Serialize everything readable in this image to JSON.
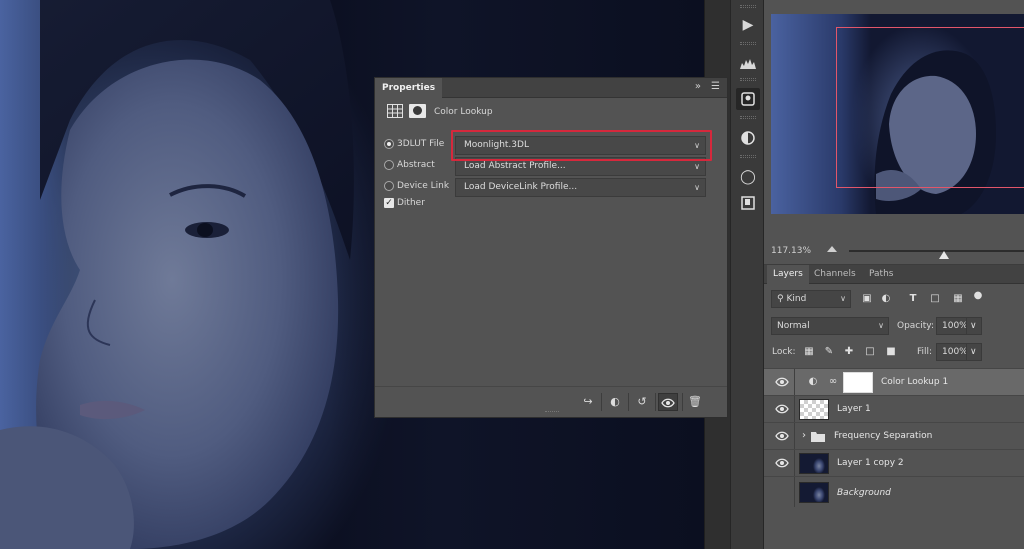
{
  "properties": {
    "title": "Properties",
    "adjustment_type": "Color Lookup",
    "options": [
      {
        "label": "3DLUT File",
        "selected": true,
        "dropdown": "Moonlight.3DL"
      },
      {
        "label": "Abstract",
        "selected": false,
        "dropdown": "Load Abstract Profile..."
      },
      {
        "label": "Device Link",
        "selected": false,
        "dropdown": "Load DeviceLink Profile..."
      }
    ],
    "dither": {
      "label": "Dither",
      "checked": true
    },
    "highlight_color": "#d6283c"
  },
  "navigator": {
    "zoom": "117.13%",
    "view_box_color": "#e2566a"
  },
  "layers_panel": {
    "tabs": [
      "Layers",
      "Channels",
      "Paths"
    ],
    "active_tab": "Layers",
    "filter_kind": "Kind",
    "blend_mode": "Normal",
    "opacity_label": "Opacity:",
    "opacity_value": "100%",
    "lock_label": "Lock:",
    "fill_label": "Fill:",
    "fill_value": "100%",
    "layers": [
      {
        "name": "Color Lookup 1",
        "visible": true,
        "selected": true
      },
      {
        "name": "Layer 1",
        "visible": true,
        "selected": false
      },
      {
        "name": "Frequency Separation",
        "visible": true,
        "selected": false,
        "group": true
      },
      {
        "name": "Layer 1 copy 2",
        "visible": true,
        "selected": false
      },
      {
        "name": "Background",
        "visible": false,
        "selected": false
      }
    ]
  }
}
